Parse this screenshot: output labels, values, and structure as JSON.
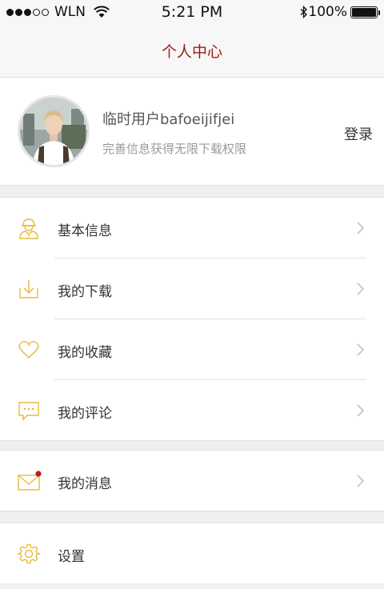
{
  "status": {
    "carrier": "WLN",
    "time": "5:21 PM",
    "battery": "100%",
    "battery_level": 1.0
  },
  "nav": {
    "title": "个人中心"
  },
  "profile": {
    "name": "临时用户bafoeijifjei",
    "subtitle": "完善信息获得无限下载权限",
    "login": "登录"
  },
  "menu": [
    {
      "label": "基本信息",
      "icon": "user-icon"
    },
    {
      "label": "我的下载",
      "icon": "download-icon"
    },
    {
      "label": "我的收藏",
      "icon": "heart-icon"
    },
    {
      "label": "我的评论",
      "icon": "comment-icon"
    }
  ],
  "messages": {
    "label": "我的消息",
    "icon": "mail-icon",
    "has_unread": true
  },
  "settings": {
    "label": "设置",
    "icon": "gear-icon"
  },
  "colors": {
    "accent": "#e8b93a",
    "title": "#9b1c12",
    "badge": "#b81c1c"
  }
}
